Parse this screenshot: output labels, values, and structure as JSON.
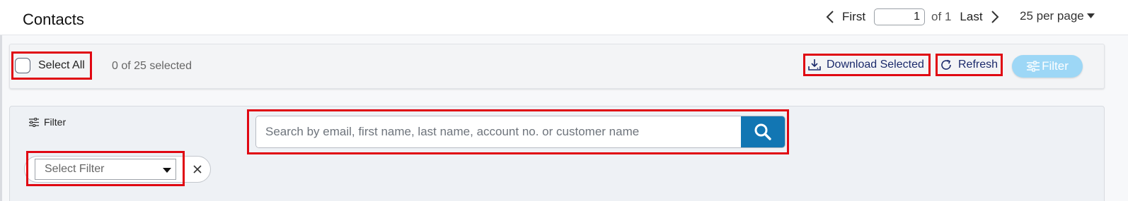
{
  "header": {
    "title": "Contacts"
  },
  "pagination": {
    "prev_icon": "chevron-left-icon",
    "first_label": "First",
    "current_page": "1",
    "of_label": "of 1",
    "last_label": "Last",
    "next_icon": "chevron-right-icon",
    "per_page_label": "25 per page"
  },
  "toolbar": {
    "select_all_label": "Select All",
    "selected_count": "0 of 25 selected",
    "download_label": "Download Selected",
    "refresh_label": "Refresh",
    "filter_button_label": "Filter",
    "accent_color": "#9dd7f6",
    "link_color": "#1b2a6b"
  },
  "filter_panel": {
    "title": "Filter",
    "search_placeholder": "Search by email, first name, last name, account no. or customer name",
    "search_value": "",
    "search_button_color": "#1276b3",
    "select_filter_value": "Select Filter"
  },
  "highlight_color": "#e00712"
}
